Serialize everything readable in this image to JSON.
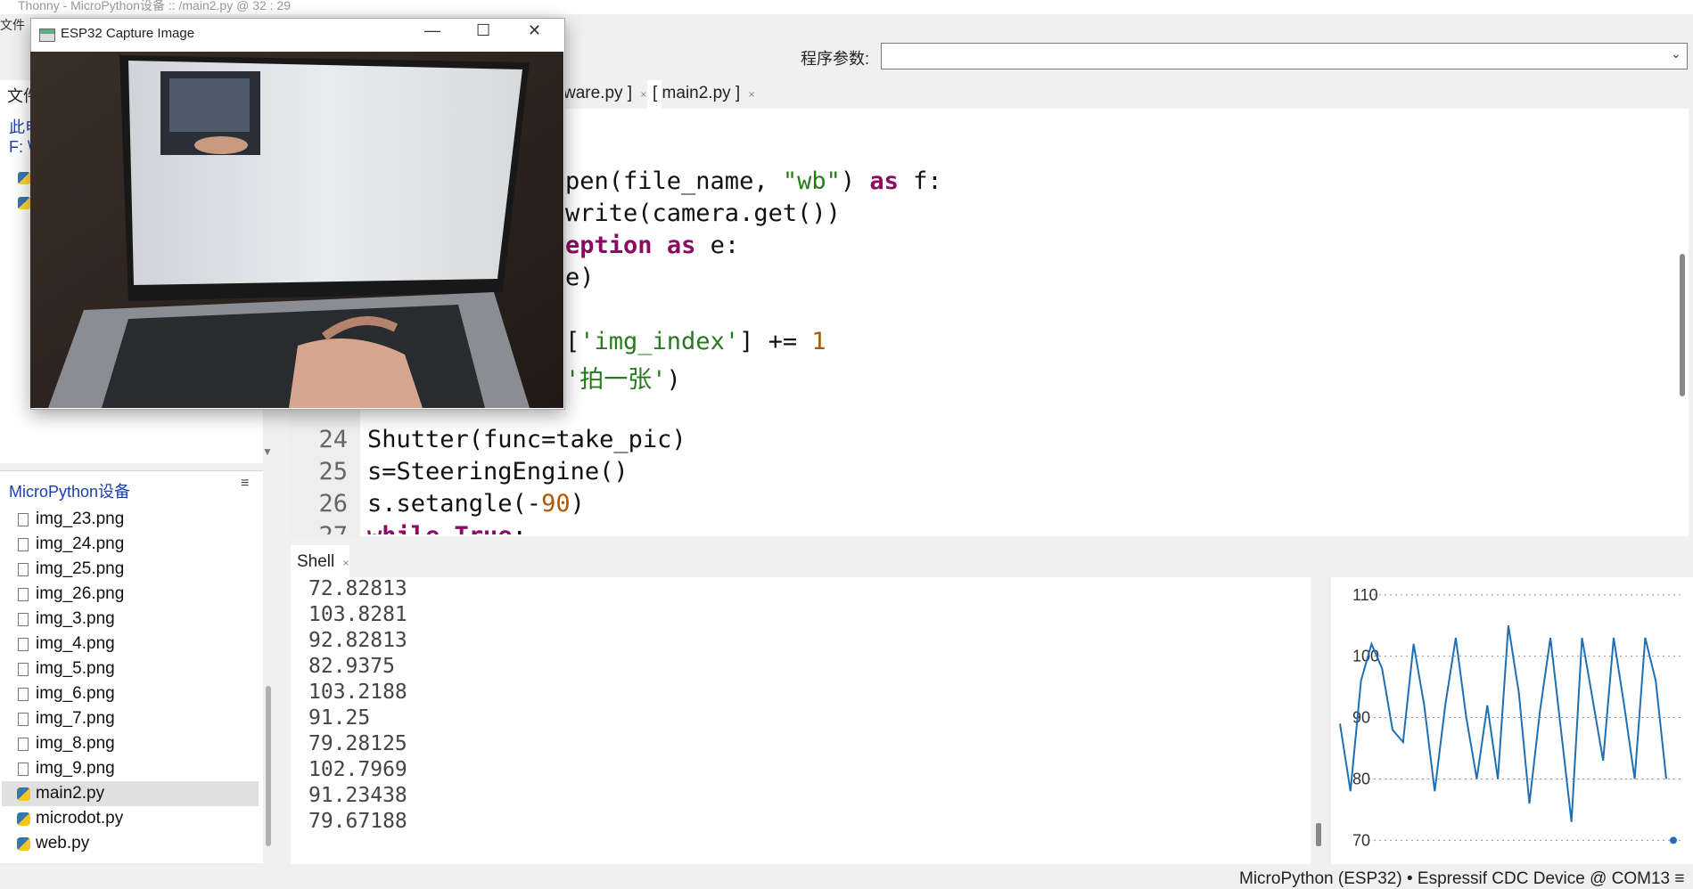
{
  "window": {
    "title": "Thonny  -  MicroPython设备 :: /main2.py  @  32 : 29"
  },
  "menu": {
    "file": "文件"
  },
  "toolbar": {
    "args_label": "程序参数:",
    "args_value": ""
  },
  "files_pane": {
    "tab_label": "文件",
    "path_line1": "此电",
    "path_line2": "F: \\"
  },
  "device_pane": {
    "title": "MicroPython设备",
    "menu_icon": "≡",
    "files": [
      {
        "name": "img_23.png",
        "type": "file"
      },
      {
        "name": "img_24.png",
        "type": "file"
      },
      {
        "name": "img_25.png",
        "type": "file"
      },
      {
        "name": "img_26.png",
        "type": "file"
      },
      {
        "name": "img_3.png",
        "type": "file"
      },
      {
        "name": "img_4.png",
        "type": "file"
      },
      {
        "name": "img_5.png",
        "type": "file"
      },
      {
        "name": "img_6.png",
        "type": "file"
      },
      {
        "name": "img_7.png",
        "type": "file"
      },
      {
        "name": "img_8.png",
        "type": "file"
      },
      {
        "name": "img_9.png",
        "type": "file"
      },
      {
        "name": "main2.py",
        "type": "python",
        "selected": true
      },
      {
        "name": "microdot.py",
        "type": "python"
      },
      {
        "name": "web.py",
        "type": "python"
      }
    ]
  },
  "editor": {
    "tabs": [
      {
        "label": "ware.py ]"
      },
      {
        "label": "[ main2.py ]",
        "active": true
      }
    ],
    "tab_close": "×",
    "visible_line_numbers": [
      "24",
      "25",
      "26"
    ],
    "partial_line_number_top": "23",
    "partial_line_number_bottom": "27"
  },
  "shell": {
    "tab_label": "Shell",
    "tab_close": "×",
    "output": [
      "72.82813",
      "103.8281",
      "92.82813",
      "82.9375",
      "103.2188",
      "91.25",
      "79.28125",
      "102.7969",
      "91.23438",
      "79.67188"
    ]
  },
  "chart_data": {
    "type": "line",
    "title": "",
    "xlabel": "",
    "ylabel": "",
    "ylim": [
      67,
      112
    ],
    "yticks": [
      70,
      80,
      90,
      100,
      110
    ],
    "grid": "horizontal-dotted",
    "series": [
      {
        "color": "#1f6fb5",
        "values": [
          89,
          78,
          96,
          102,
          98,
          88,
          86,
          102,
          92,
          78,
          92,
          103,
          90,
          80,
          92,
          80,
          105,
          94,
          76,
          91,
          103,
          88,
          73,
          103,
          93,
          83,
          103,
          92,
          80,
          103,
          96,
          80
        ]
      }
    ]
  },
  "capture_window": {
    "title": "ESP32 Capture Image",
    "minimize": "—",
    "maximize": "☐",
    "close": "✕"
  },
  "statusbar": {
    "text": "MicroPython (ESP32)  •  Espressif CDC Device @ COM13  ≡"
  },
  "colors": {
    "keyword": "#8b0a63",
    "string": "#257c1a",
    "number": "#b35600",
    "plot_line": "#1f6fb5",
    "link": "#1a3fae"
  }
}
